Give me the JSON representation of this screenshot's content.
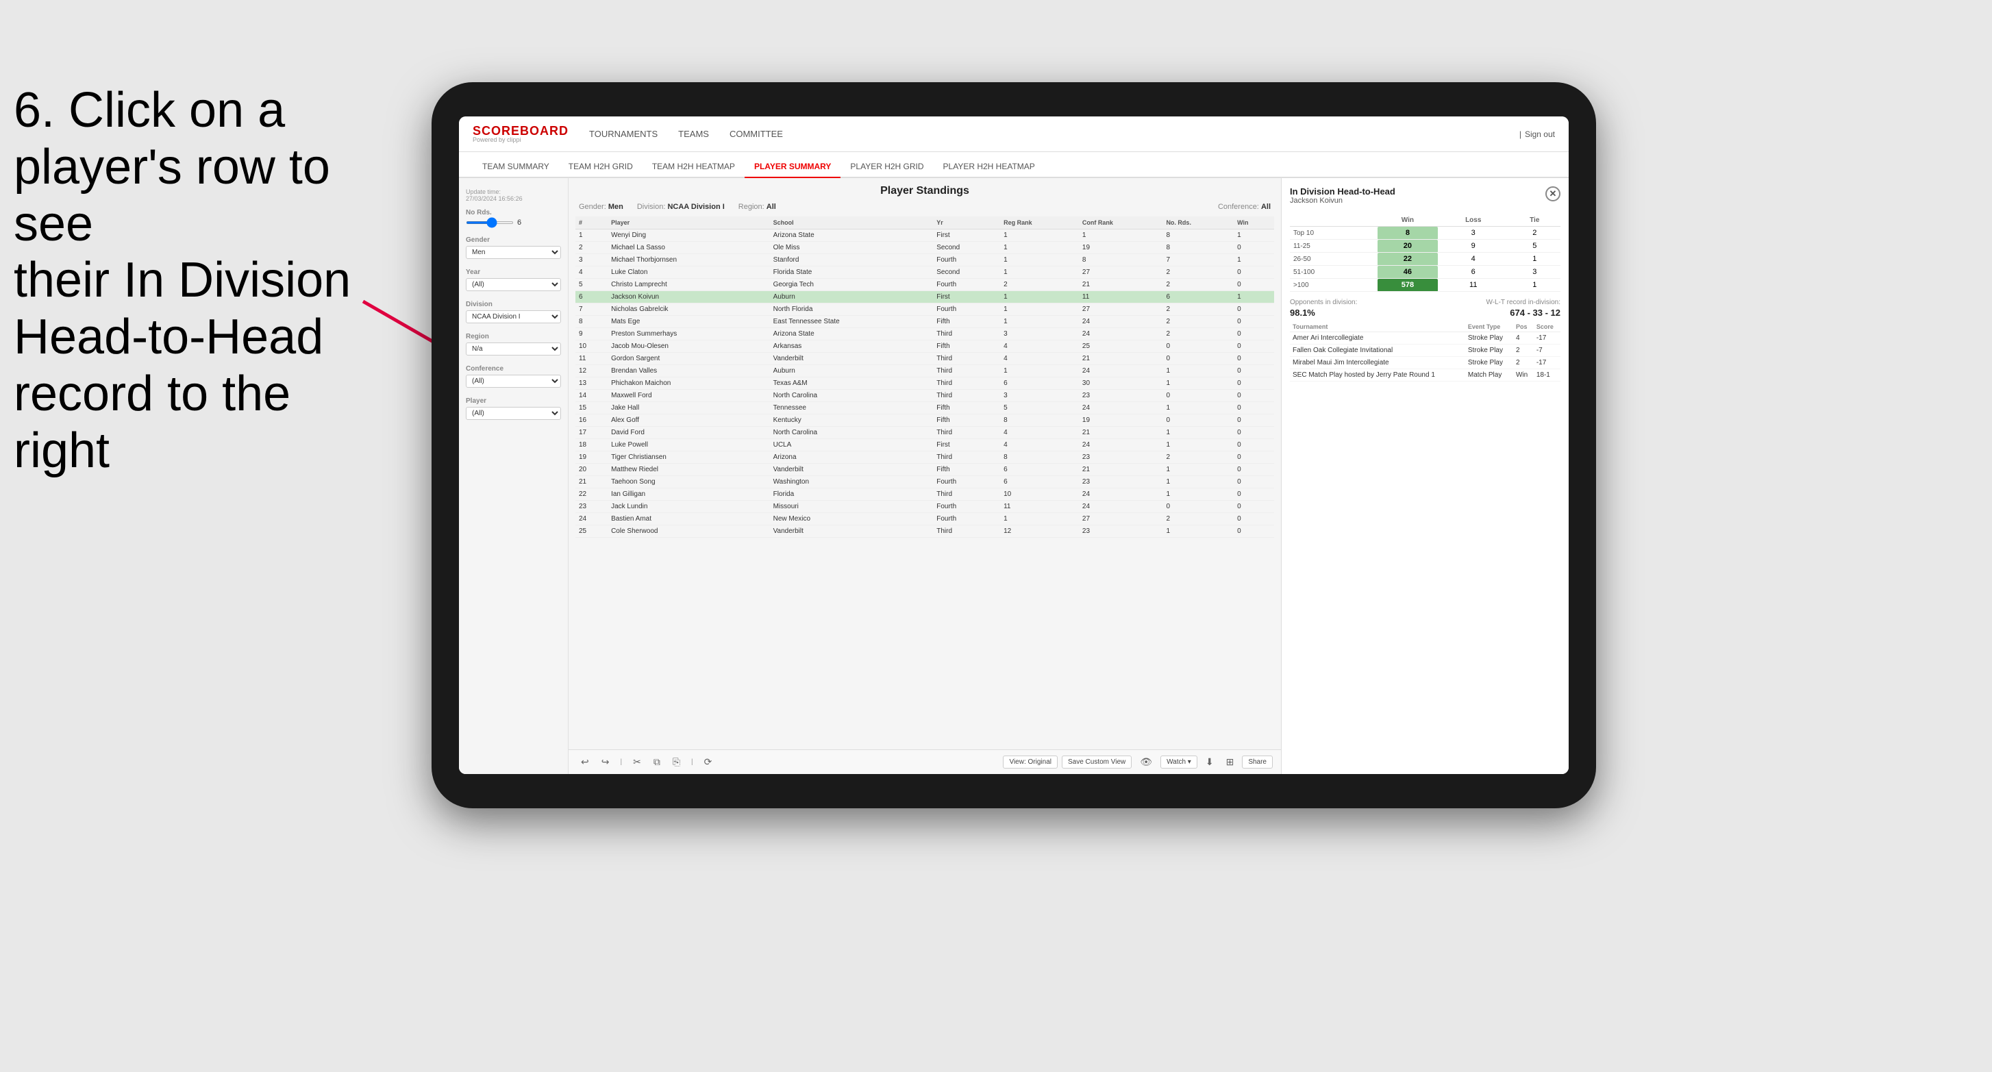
{
  "instruction": {
    "line1": "6. Click on a",
    "line2": "player's row to see",
    "line3": "their In Division",
    "line4": "Head-to-Head",
    "line5": "record to the right"
  },
  "nav": {
    "logo": "SCOREBOARD",
    "powered_by": "Powered by clippi",
    "links": [
      "TOURNAMENTS",
      "TEAMS",
      "COMMITTEE"
    ],
    "sign_out": "Sign out"
  },
  "sub_nav": {
    "links": [
      "TEAM SUMMARY",
      "TEAM H2H GRID",
      "TEAM H2H HEATMAP",
      "PLAYER SUMMARY",
      "PLAYER H2H GRID",
      "PLAYER H2H HEATMAP"
    ],
    "active": "PLAYER SUMMARY"
  },
  "sidebar": {
    "update_label": "Update time:",
    "update_time": "27/03/2024 16:56:26",
    "no_rds_label": "No Rds.",
    "no_rds_value": "6",
    "gender_label": "Gender",
    "gender_value": "Men",
    "year_label": "Year",
    "year_value": "(All)",
    "division_label": "Division",
    "division_value": "NCAA Division I",
    "region_label": "Region",
    "region_value": "N/a",
    "conference_label": "Conference",
    "conference_value": "(All)",
    "player_label": "Player",
    "player_value": "(All)"
  },
  "standings": {
    "title": "Player Standings",
    "filters": {
      "gender_label": "Gender:",
      "gender_value": "Men",
      "division_label": "Division:",
      "division_value": "NCAA Division I",
      "region_label": "Region:",
      "region_value": "All",
      "conference_label": "Conference:",
      "conference_value": "All"
    },
    "columns": [
      "#",
      "Player",
      "School",
      "Yr",
      "Reg Rank",
      "Conf Rank",
      "No. Rds.",
      "Win"
    ],
    "rows": [
      {
        "num": 1,
        "player": "Wenyi Ding",
        "school": "Arizona State",
        "yr": "First",
        "reg": 1,
        "conf": 1,
        "rds": 8,
        "win": 1
      },
      {
        "num": 2,
        "player": "Michael La Sasso",
        "school": "Ole Miss",
        "yr": "Second",
        "reg": 1,
        "conf": 19,
        "rds": 8,
        "win": 0
      },
      {
        "num": 3,
        "player": "Michael Thorbjornsen",
        "school": "Stanford",
        "yr": "Fourth",
        "reg": 1,
        "conf": 8,
        "rds": 7,
        "win": 1
      },
      {
        "num": 4,
        "player": "Luke Claton",
        "school": "Florida State",
        "yr": "Second",
        "reg": 1,
        "conf": 27,
        "rds": 2,
        "win": 0
      },
      {
        "num": 5,
        "player": "Christo Lamprecht",
        "school": "Georgia Tech",
        "yr": "Fourth",
        "reg": 2,
        "conf": 21,
        "rds": 2,
        "win": 0
      },
      {
        "num": 6,
        "player": "Jackson Koivun",
        "school": "Auburn",
        "yr": "First",
        "reg": 1,
        "conf": 11,
        "rds": 6,
        "win": 1,
        "highlighted": true
      },
      {
        "num": 7,
        "player": "Nicholas Gabrelcik",
        "school": "North Florida",
        "yr": "Fourth",
        "reg": 1,
        "conf": 27,
        "rds": 2,
        "win": 0
      },
      {
        "num": 8,
        "player": "Mats Ege",
        "school": "East Tennessee State",
        "yr": "Fifth",
        "reg": 1,
        "conf": 24,
        "rds": 2,
        "win": 0
      },
      {
        "num": 9,
        "player": "Preston Summerhays",
        "school": "Arizona State",
        "yr": "Third",
        "reg": 3,
        "conf": 24,
        "rds": 2,
        "win": 0
      },
      {
        "num": 10,
        "player": "Jacob Mou-Olesen",
        "school": "Arkansas",
        "yr": "Fifth",
        "reg": 4,
        "conf": 25,
        "rds": 0,
        "win": 0
      },
      {
        "num": 11,
        "player": "Gordon Sargent",
        "school": "Vanderbilt",
        "yr": "Third",
        "reg": 4,
        "conf": 21,
        "rds": 0,
        "win": 0
      },
      {
        "num": 12,
        "player": "Brendan Valles",
        "school": "Auburn",
        "yr": "Third",
        "reg": 1,
        "conf": 24,
        "rds": 1,
        "win": 0
      },
      {
        "num": 13,
        "player": "Phichakon Maichon",
        "school": "Texas A&M",
        "yr": "Third",
        "reg": 6,
        "conf": 30,
        "rds": 1,
        "win": 0
      },
      {
        "num": 14,
        "player": "Maxwell Ford",
        "school": "North Carolina",
        "yr": "Third",
        "reg": 3,
        "conf": 23,
        "rds": 0,
        "win": 0
      },
      {
        "num": 15,
        "player": "Jake Hall",
        "school": "Tennessee",
        "yr": "Fifth",
        "reg": 5,
        "conf": 24,
        "rds": 1,
        "win": 0
      },
      {
        "num": 16,
        "player": "Alex Goff",
        "school": "Kentucky",
        "yr": "Fifth",
        "reg": 8,
        "conf": 19,
        "rds": 0,
        "win": 0
      },
      {
        "num": 17,
        "player": "David Ford",
        "school": "North Carolina",
        "yr": "Third",
        "reg": 4,
        "conf": 21,
        "rds": 1,
        "win": 0
      },
      {
        "num": 18,
        "player": "Luke Powell",
        "school": "UCLA",
        "yr": "First",
        "reg": 4,
        "conf": 24,
        "rds": 1,
        "win": 0
      },
      {
        "num": 19,
        "player": "Tiger Christiansen",
        "school": "Arizona",
        "yr": "Third",
        "reg": 8,
        "conf": 23,
        "rds": 2,
        "win": 0
      },
      {
        "num": 20,
        "player": "Matthew Riedel",
        "school": "Vanderbilt",
        "yr": "Fifth",
        "reg": 6,
        "conf": 21,
        "rds": 1,
        "win": 0
      },
      {
        "num": 21,
        "player": "Taehoon Song",
        "school": "Washington",
        "yr": "Fourth",
        "reg": 6,
        "conf": 23,
        "rds": 1,
        "win": 0
      },
      {
        "num": 22,
        "player": "Ian Gilligan",
        "school": "Florida",
        "yr": "Third",
        "reg": 10,
        "conf": 24,
        "rds": 1,
        "win": 0
      },
      {
        "num": 23,
        "player": "Jack Lundin",
        "school": "Missouri",
        "yr": "Fourth",
        "reg": 11,
        "conf": 24,
        "rds": 0,
        "win": 0
      },
      {
        "num": 24,
        "player": "Bastien Amat",
        "school": "New Mexico",
        "yr": "Fourth",
        "reg": 1,
        "conf": 27,
        "rds": 2,
        "win": 0
      },
      {
        "num": 25,
        "player": "Cole Sherwood",
        "school": "Vanderbilt",
        "yr": "Third",
        "reg": 12,
        "conf": 23,
        "rds": 1,
        "win": 0
      }
    ]
  },
  "h2h": {
    "title": "In Division Head-to-Head",
    "player_name": "Jackson Koivun",
    "columns": [
      "",
      "Win",
      "Loss",
      "Tie"
    ],
    "rows": [
      {
        "range": "Top 10",
        "win": 8,
        "loss": 3,
        "tie": 2,
        "win_style": "light"
      },
      {
        "range": "11-25",
        "win": 20,
        "loss": 9,
        "tie": 5,
        "win_style": "light"
      },
      {
        "range": "26-50",
        "win": 22,
        "loss": 4,
        "tie": 1,
        "win_style": "light"
      },
      {
        "range": "51-100",
        "win": 46,
        "loss": 6,
        "tie": 3,
        "win_style": "light"
      },
      {
        "range": ">100",
        "win": 578,
        "loss": 11,
        "tie": 1,
        "win_style": "dark"
      }
    ],
    "opponents_label": "Opponents in division:",
    "opponents_pct": "98.1%",
    "wlt_label": "W-L-T record in-division:",
    "wlt_record": "674 - 33 - 12",
    "tournament_columns": [
      "Tournament",
      "Event Type",
      "Pos",
      "Score"
    ],
    "tournaments": [
      {
        "name": "Amer Ari Intercollegiate",
        "type": "Stroke Play",
        "pos": 4,
        "score": "-17"
      },
      {
        "name": "Fallen Oak Collegiate Invitational",
        "type": "Stroke Play",
        "pos": 2,
        "score": "-7"
      },
      {
        "name": "Mirabel Maui Jim Intercollegiate",
        "type": "Stroke Play",
        "pos": 2,
        "score": "-17"
      },
      {
        "name": "SEC Match Play hosted by Jerry Pate Round 1",
        "type": "Match Play",
        "pos": "Win",
        "score": "18-1"
      }
    ]
  },
  "toolbar": {
    "undo": "↩",
    "redo": "↪",
    "view_original": "View: Original",
    "save_custom": "Save Custom View",
    "watch": "Watch ▾",
    "share": "Share"
  }
}
